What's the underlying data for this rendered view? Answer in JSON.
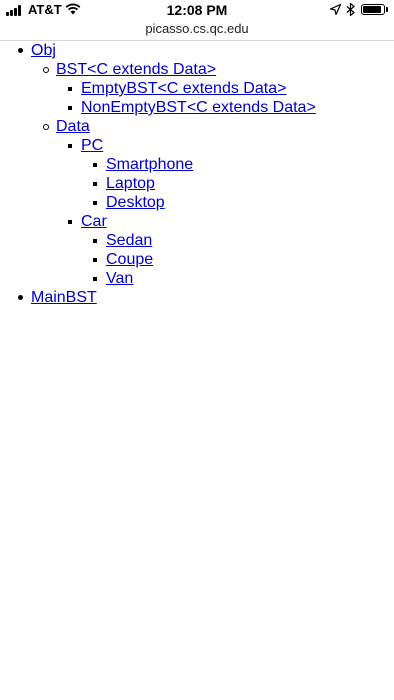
{
  "status_bar": {
    "carrier": "AT&T",
    "time": "12:08 PM",
    "battery_level": 0.9
  },
  "browser": {
    "url": "picasso.cs.qc.edu"
  },
  "tree": {
    "obj": {
      "label": "Obj",
      "bst": {
        "label": "BST<C extends Data>",
        "empty": "EmptyBST<C extends Data>",
        "nonempty": "NonEmptyBST<C extends Data>"
      },
      "data": {
        "label": "Data",
        "pc": {
          "label": "PC",
          "items": [
            "Smartphone",
            "Laptop",
            "Desktop"
          ]
        },
        "car": {
          "label": "Car",
          "items": [
            "Sedan",
            "Coupe",
            "Van"
          ]
        }
      }
    },
    "mainbst": "MainBST"
  },
  "colors": {
    "link": "#0000cc"
  }
}
